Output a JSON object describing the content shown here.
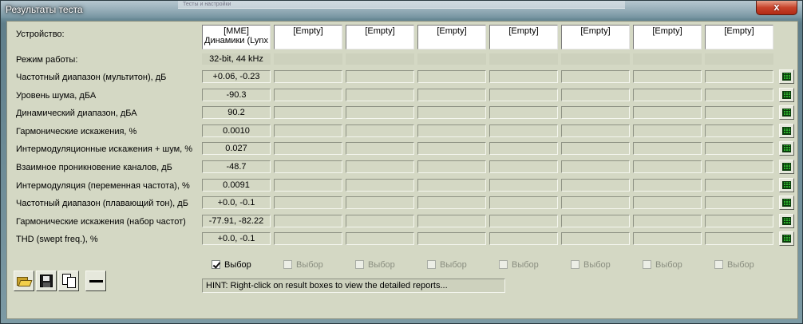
{
  "window": {
    "title": "Результаты теста",
    "background_tab": "Тесты и настройки",
    "close_label": "x"
  },
  "labels": {
    "device": "Устройство:",
    "mode": "Режим работы:"
  },
  "devices": [
    {
      "line1": "[MME]",
      "line2": "Динамики (Lynx",
      "mode": "32-bit, 44 kHz"
    },
    {
      "line1": "[Empty]",
      "line2": "",
      "mode": ""
    },
    {
      "line1": "[Empty]",
      "line2": "",
      "mode": ""
    },
    {
      "line1": "[Empty]",
      "line2": "",
      "mode": ""
    },
    {
      "line1": "[Empty]",
      "line2": "",
      "mode": ""
    },
    {
      "line1": "[Empty]",
      "line2": "",
      "mode": ""
    },
    {
      "line1": "[Empty]",
      "line2": "",
      "mode": ""
    },
    {
      "line1": "[Empty]",
      "line2": "",
      "mode": ""
    }
  ],
  "metrics": [
    {
      "label": "Частотный диапазон (мультитон), дБ",
      "values": [
        "+0.06, -0.23",
        "",
        "",
        "",
        "",
        "",
        "",
        ""
      ]
    },
    {
      "label": "Уровень шума, дБА",
      "values": [
        "-90.3",
        "",
        "",
        "",
        "",
        "",
        "",
        ""
      ]
    },
    {
      "label": "Динамический диапазон, дБА",
      "values": [
        "90.2",
        "",
        "",
        "",
        "",
        "",
        "",
        ""
      ]
    },
    {
      "label": "Гармонические искажения, %",
      "values": [
        "0.0010",
        "",
        "",
        "",
        "",
        "",
        "",
        ""
      ]
    },
    {
      "label": "Интермодуляционные искажения + шум, %",
      "values": [
        "0.027",
        "",
        "",
        "",
        "",
        "",
        "",
        ""
      ]
    },
    {
      "label": "Взаимное проникновение каналов, дБ",
      "values": [
        "-48.7",
        "",
        "",
        "",
        "",
        "",
        "",
        ""
      ]
    },
    {
      "label": "Интермодуляция (переменная частота), %",
      "values": [
        "0.0091",
        "",
        "",
        "",
        "",
        "",
        "",
        ""
      ]
    },
    {
      "label": "Частотный диапазон (плавающий тон), дБ",
      "values": [
        "+0.0, -0.1",
        "",
        "",
        "",
        "",
        "",
        "",
        ""
      ]
    },
    {
      "label": "Гармонические искажения (набор частот)",
      "values": [
        "-77.91, -82.22",
        "",
        "",
        "",
        "",
        "",
        "",
        ""
      ]
    },
    {
      "label": "THD (swept freq.), %",
      "values": [
        "+0.0, -0.1",
        "",
        "",
        "",
        "",
        "",
        "",
        ""
      ]
    }
  ],
  "select": [
    {
      "label": "Выбор",
      "checked": true,
      "enabled": true
    },
    {
      "label": "Выбор",
      "checked": false,
      "enabled": false
    },
    {
      "label": "Выбор",
      "checked": false,
      "enabled": false
    },
    {
      "label": "Выбор",
      "checked": false,
      "enabled": false
    },
    {
      "label": "Выбор",
      "checked": false,
      "enabled": false
    },
    {
      "label": "Выбор",
      "checked": false,
      "enabled": false
    },
    {
      "label": "Выбор",
      "checked": false,
      "enabled": false
    },
    {
      "label": "Выбор",
      "checked": false,
      "enabled": false
    }
  ],
  "hint": "HINT: Right-click on result boxes to view the detailed reports...",
  "toolbar": [
    {
      "icon": "open-folder-icon"
    },
    {
      "icon": "save-disk-icon"
    },
    {
      "icon": "copy-icon"
    },
    {
      "icon": "minus-icon"
    }
  ]
}
